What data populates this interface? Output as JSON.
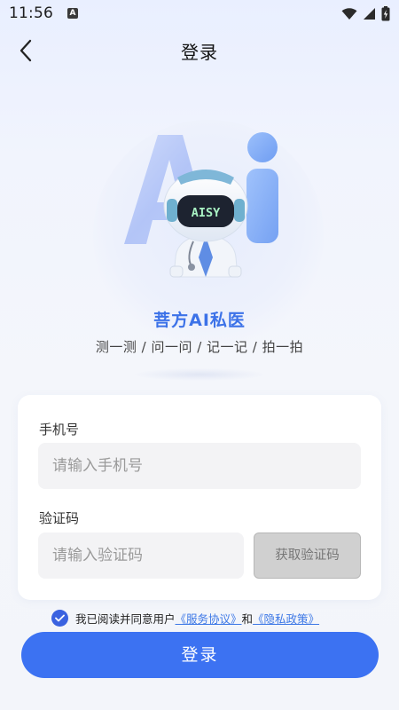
{
  "status_bar": {
    "time": "11:56",
    "notification_icon": "A"
  },
  "header": {
    "title": "登录",
    "back_icon": "chevron-left-icon"
  },
  "hero": {
    "logo_text": "AISY",
    "brand_name": "菩方AI私医",
    "slogan": "测一测 / 问一问 / 记一记 / 拍一拍"
  },
  "form": {
    "phone_label": "手机号",
    "phone_placeholder": "请输入手机号",
    "phone_value": "",
    "code_label": "验证码",
    "code_placeholder": "请输入验证码",
    "code_value": "",
    "get_code_label": "获取验证码"
  },
  "agreement": {
    "checked": true,
    "prefix": "我已阅读并同意用户",
    "service_link": "《服务协议》",
    "and": "和",
    "privacy_link": "《隐私政策》"
  },
  "login_button": "登录",
  "colors": {
    "primary": "#3c72f2",
    "brand_text": "#3c72e8",
    "link": "#3d78e6",
    "disabled_button": "#d0d0d0"
  }
}
